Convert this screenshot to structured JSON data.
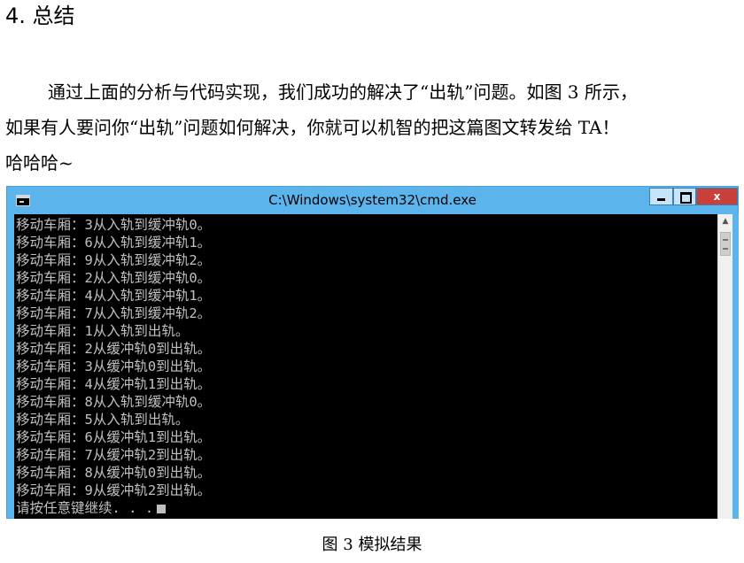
{
  "heading": "4. 总结",
  "paragraph": {
    "lines": [
      "通过上面的分析与代码实现，我们成功的解决了“出轨”问题。如图 3 所示，",
      "如果有人要问你“出轨”问题如何解决，你就可以机智的把这篇图文转发给 TA！",
      "哈哈哈~"
    ]
  },
  "window": {
    "title": "C:\\Windows\\system32\\cmd.exe",
    "icon": "cmd-icon",
    "buttons": {
      "minimize": "minimize-icon",
      "maximize": "maximize-icon",
      "close": "x"
    },
    "colors": {
      "titlebar": "#5bb4ec",
      "close": "#c9403a",
      "console_bg": "#000000",
      "console_text": "#c0c0c0"
    }
  },
  "console": {
    "lines": [
      "移动车厢：3从入轨到缓冲轨0。",
      "移动车厢：6从入轨到缓冲轨1。",
      "移动车厢：9从入轨到缓冲轨2。",
      "移动车厢：2从入轨到缓冲轨0。",
      "移动车厢：4从入轨到缓冲轨1。",
      "移动车厢：7从入轨到缓冲轨2。",
      "移动车厢：1从入轨到出轨。",
      "移动车厢：2从缓冲轨0到出轨。",
      "移动车厢：3从缓冲轨0到出轨。",
      "移动车厢：4从缓冲轨1到出轨。",
      "移动车厢：8从入轨到缓冲轨0。",
      "移动车厢：5从入轨到出轨。",
      "移动车厢：6从缓冲轨1到出轨。",
      "移动车厢：7从缓冲轨2到出轨。",
      "移动车厢：8从缓冲轨0到出轨。",
      "移动车厢：9从缓冲轨2到出轨。"
    ],
    "prompt": "请按任意键继续. . ."
  },
  "caption": "图 3  模拟结果"
}
